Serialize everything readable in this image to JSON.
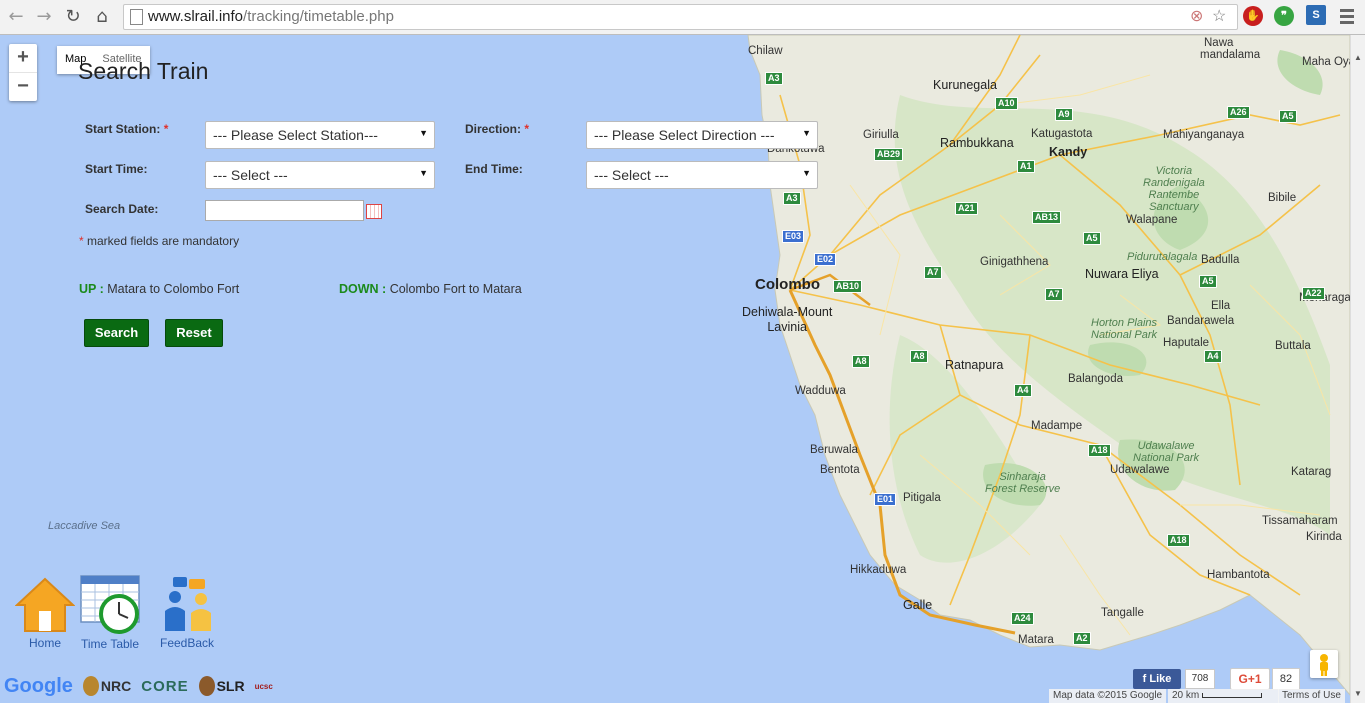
{
  "browser": {
    "url_domain": "www.slrail.info",
    "url_path": "/tracking/timetable.php"
  },
  "map": {
    "zoom_in": "+",
    "zoom_out": "−",
    "type_map": "Map",
    "type_satellite": "Satellite",
    "labels": {
      "chilaw": "Chilaw",
      "kurunegala": "Kurunegala",
      "nawa": "Nawa",
      "mandalama": "mandalama",
      "maha_oya": "Maha Oya",
      "giriulla": "Giriulla",
      "rambukkana": "Rambukkana",
      "katugastota": "Katugastota",
      "kandy": "Kandy",
      "mahiyanganaya": "Mahiyanganaya",
      "dankotuwa": "Dankotuwa",
      "victoria": "Victoria\nRandenigala\nRantembe\nSanctuary",
      "bibile": "Bibile",
      "walapane": "Walapane",
      "colombo": "Colombo",
      "ginigathhena": "Ginigathhena",
      "pidurutalagala": "Pidurutalagala",
      "badulla": "Badulla",
      "nuwara_eliya": "Nuwara Eliya",
      "monaragala": "Monaragala",
      "dehiwala": "Dehiwala-Mount\nLavinia",
      "ella": "Ella",
      "horton": "Horton Plains\nNational Park",
      "bandarawela": "Bandarawela",
      "haputale": "Haputale",
      "buttala": "Buttala",
      "ratnapura": "Ratnapura",
      "balangoda": "Balangoda",
      "wadduwa": "Wadduwa",
      "madampe": "Madampe",
      "beruwala": "Beruwala",
      "udawalawe_np": "Udawalawe\nNational Park",
      "bentota": "Bentota",
      "udawalawe": "Udawalawe",
      "kataragama": "Katarag",
      "sinharaja": "Sinharaja\nForest Reserve",
      "pitigala": "Pitigala",
      "tissamaharama": "Tissamaharam",
      "kirinda": "Kirinda",
      "hikkaduwa": "Hikkaduwa",
      "hambantota": "Hambantota",
      "galle": "Galle",
      "tangalle": "Tangalle",
      "matara": "Matara",
      "laccadive": "Laccadive Sea"
    },
    "shields": {
      "a3a": "A3",
      "a10": "A10",
      "a9": "A9",
      "a26": "A26",
      "a5a": "A5",
      "ab29": "AB29",
      "a1": "A1",
      "a3b": "A3",
      "a21": "A21",
      "ab13": "AB13",
      "a5b": "A5",
      "e03": "E03",
      "e02": "E02",
      "a7a": "A7",
      "ab10": "AB10",
      "a7b": "A7",
      "a5c": "A5",
      "a22": "A22",
      "a8a": "A8",
      "a8b": "A8",
      "a4a": "A4",
      "a4b": "A4",
      "a18a": "A18",
      "e01": "E01",
      "a18b": "A18",
      "a24": "A24",
      "a2": "A2"
    },
    "attribution": "Map data ©2015 Google",
    "scale": "20 km",
    "terms": "Terms of Use"
  },
  "form": {
    "title": "Search Train",
    "start_station_label": "Start Station:",
    "direction_label": "Direction:",
    "start_time_label": "Start Time:",
    "end_time_label": "End Time:",
    "search_date_label": "Search Date:",
    "required_mark": "*",
    "start_station_value": "--- Please Select Station---",
    "direction_value": "--- Please Select Direction ---",
    "start_time_value": "--- Select ---",
    "end_time_value": "--- Select ---",
    "search_date_value": "",
    "mandatory_note": "marked fields are mandatory",
    "up_label": "UP :",
    "up_text": "Matara to Colombo Fort",
    "down_label": "DOWN :",
    "down_text": "Colombo Fort to Matara",
    "search_button": "Search",
    "reset_button": "Reset"
  },
  "nav_icons": {
    "home": "Home",
    "timetable": "Time Table",
    "feedback": "FeedBack"
  },
  "footer_logos": {
    "google": "Google",
    "nrc": "NRC",
    "core": "CORE",
    "slr": "SLR",
    "ucsc": "ucsc"
  },
  "social": {
    "fb_like": "Like",
    "fb_count": "708",
    "gplus": "G+1",
    "gplus_count": "82"
  }
}
